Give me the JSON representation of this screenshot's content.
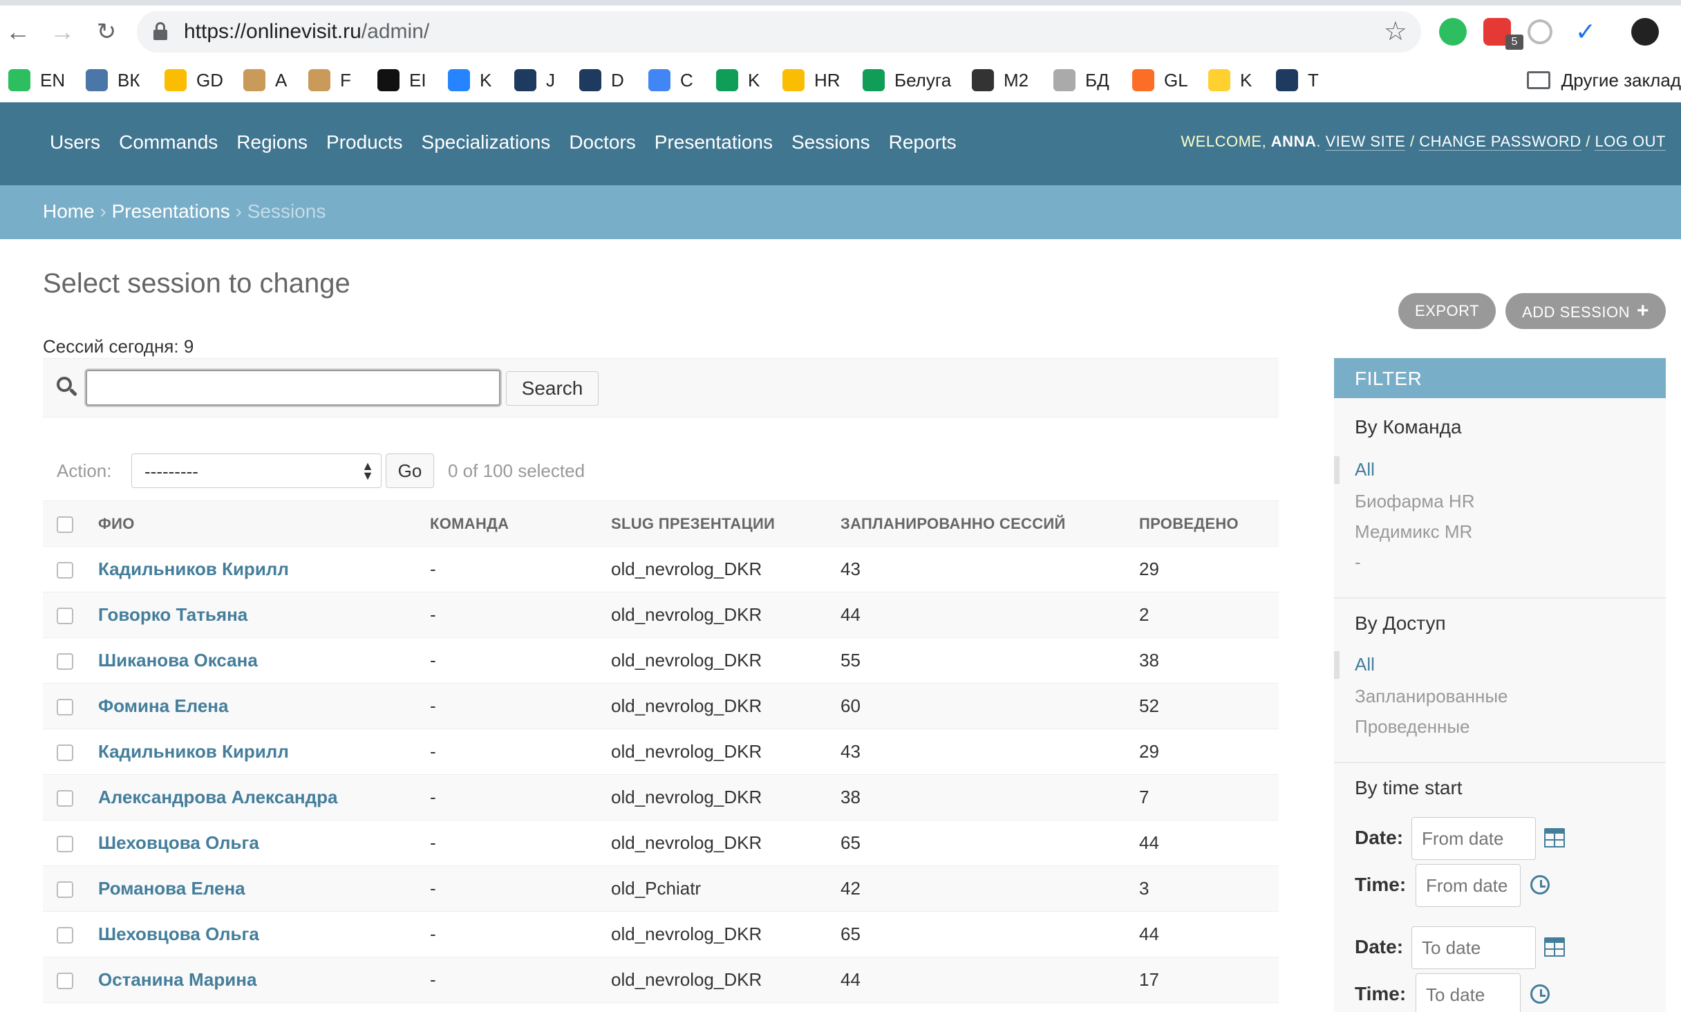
{
  "browser": {
    "url_base": "https://onlinevisit.ru",
    "url_path": "/admin/",
    "extension_badge": "5",
    "bookmarks": [
      {
        "label": "EN",
        "icon": "evernote-icon",
        "color": "#2dbe60"
      },
      {
        "label": "ВК",
        "icon": "vk-icon",
        "color": "#4a76a8"
      },
      {
        "label": "GD",
        "icon": "google-drive-icon",
        "color": "#fbbc04"
      },
      {
        "label": "A",
        "icon": "ship-icon",
        "color": "#c99a5a"
      },
      {
        "label": "F",
        "icon": "ship-icon",
        "color": "#c99a5a"
      },
      {
        "label": "EI",
        "icon": "eb-icon",
        "color": "#111111"
      },
      {
        "label": "K",
        "icon": "confluence-icon",
        "color": "#2684ff"
      },
      {
        "label": "J",
        "icon": "jenkins-icon",
        "color": "#1e3a5f"
      },
      {
        "label": "D",
        "icon": "jenkins-icon",
        "color": "#1e3a5f"
      },
      {
        "label": "C",
        "icon": "calendar-icon",
        "color": "#4285f4"
      },
      {
        "label": "K",
        "icon": "sheets-icon",
        "color": "#0f9d58"
      },
      {
        "label": "HR",
        "icon": "google-drive-icon",
        "color": "#fbbc04"
      },
      {
        "label": "Белуга",
        "icon": "sheets-icon",
        "color": "#0f9d58"
      },
      {
        "label": "M2",
        "icon": "m2-icon",
        "color": "#333333"
      },
      {
        "label": "БД",
        "icon": "db-icon",
        "color": "#aaaaaa"
      },
      {
        "label": "GL",
        "icon": "gitlab-icon",
        "color": "#fc6d26"
      },
      {
        "label": "K",
        "icon": "miro-icon",
        "color": "#ffd02f"
      },
      {
        "label": "T",
        "icon": "jenkins-icon",
        "color": "#1e3a5f"
      }
    ],
    "other_bookmarks": "Другие заклад"
  },
  "header": {
    "nav": [
      "Users",
      "Commands",
      "Regions",
      "Products",
      "Specializations",
      "Doctors",
      "Presentations",
      "Sessions",
      "Reports"
    ],
    "welcome": "WELCOME, ",
    "username": "ANNA",
    "view_site": "VIEW SITE",
    "change_password": "CHANGE PASSWORD",
    "log_out": "LOG OUT"
  },
  "breadcrumbs": {
    "home": "Home",
    "presentations": "Presentations",
    "current": "Sessions"
  },
  "page": {
    "title": "Select session to change",
    "export_label": "EXPORT",
    "add_label": "ADD SESSION",
    "sessions_today": "Сессий сегодня: 9"
  },
  "search": {
    "value": "",
    "button": "Search"
  },
  "actions": {
    "label": "Action:",
    "selected_option": "---------",
    "go": "Go",
    "counter": "0 of 100 selected"
  },
  "table": {
    "headers": [
      "ФИО",
      "КОМАНДА",
      "SLUG ПРЕЗЕНТАЦИИ",
      "ЗАПЛАНИРОВАННО СЕССИЙ",
      "ПРОВЕДЕНО"
    ],
    "rows": [
      {
        "fio": "Кадильников Кирилл",
        "team": "-",
        "slug": "old_nevrolog_DKR",
        "planned": "43",
        "done": "29"
      },
      {
        "fio": "Говорко Татьяна",
        "team": "-",
        "slug": "old_nevrolog_DKR",
        "planned": "44",
        "done": "2"
      },
      {
        "fio": "Шиканова Оксана",
        "team": "-",
        "slug": "old_nevrolog_DKR",
        "planned": "55",
        "done": "38"
      },
      {
        "fio": "Фомина Елена",
        "team": "-",
        "slug": "old_nevrolog_DKR",
        "planned": "60",
        "done": "52"
      },
      {
        "fio": "Кадильников Кирилл",
        "team": "-",
        "slug": "old_nevrolog_DKR",
        "planned": "43",
        "done": "29"
      },
      {
        "fio": "Александрова Александра",
        "team": "-",
        "slug": "old_nevrolog_DKR",
        "planned": "38",
        "done": "7"
      },
      {
        "fio": "Шеховцова Ольга",
        "team": "-",
        "slug": "old_nevrolog_DKR",
        "planned": "65",
        "done": "44"
      },
      {
        "fio": "Романова Елена",
        "team": "-",
        "slug": "old_Pchiatr",
        "planned": "42",
        "done": "3"
      },
      {
        "fio": "Шеховцова Ольга",
        "team": "-",
        "slug": "old_nevrolog_DKR",
        "planned": "65",
        "done": "44"
      },
      {
        "fio": "Останина Марина",
        "team": "-",
        "slug": "old_nevrolog_DKR",
        "planned": "44",
        "done": "17"
      }
    ]
  },
  "filter": {
    "title": "FILTER",
    "by_team": {
      "title": "By Команда",
      "items": [
        "All",
        "Биофарма HR",
        "Медимикс MR",
        "-"
      ]
    },
    "by_access": {
      "title": "By Доступ",
      "items": [
        "All",
        "Запланированные",
        "Проведенные"
      ]
    },
    "by_time": {
      "title": "By time start",
      "date_label": "Date:",
      "time_label": "Time:",
      "from_placeholder": "From date",
      "to_placeholder": "To date"
    }
  }
}
